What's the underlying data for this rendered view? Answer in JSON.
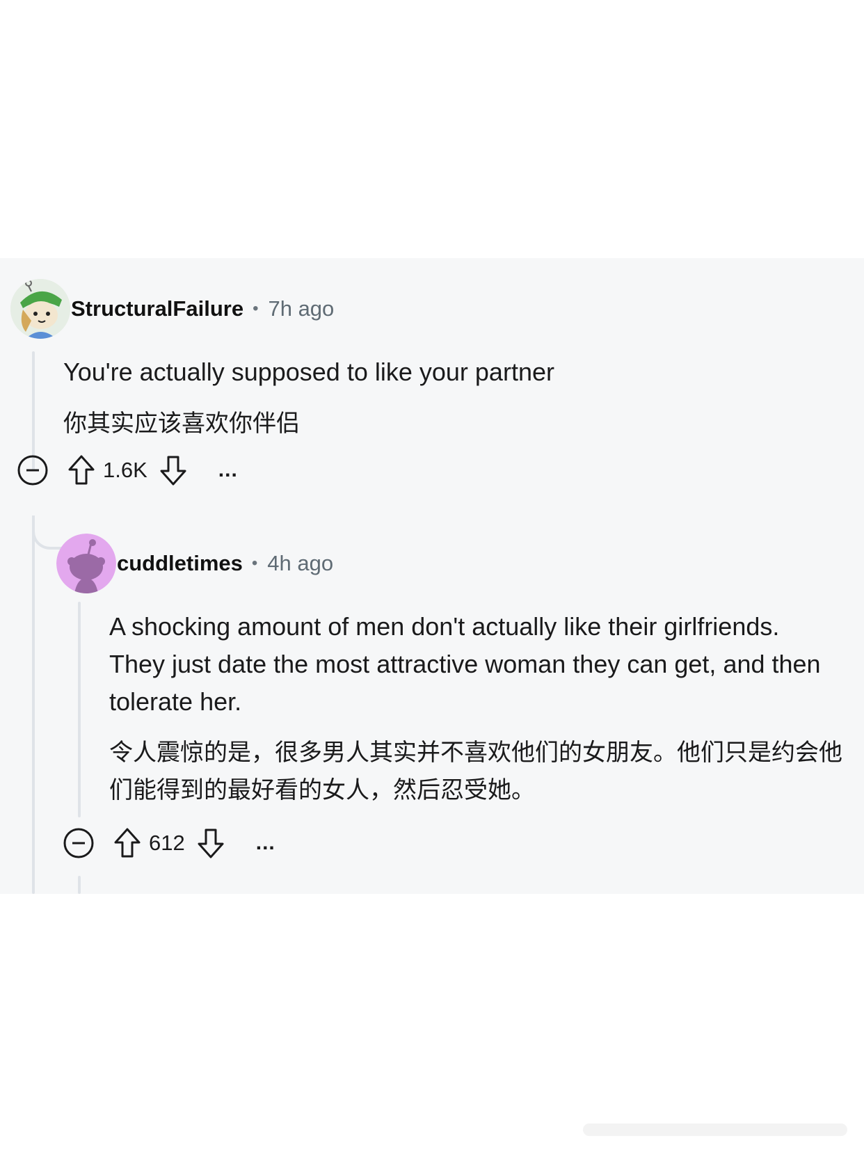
{
  "comments": [
    {
      "username": "StructuralFailure",
      "separator": "•",
      "time": "7h ago",
      "text_en": "You're actually supposed to like your partner",
      "text_zh": "你其实应该喜欢你伴侣",
      "votes": "1.6K",
      "more_label": "..."
    },
    {
      "username": "cuddletimes",
      "separator": "•",
      "time": "4h ago",
      "text_en": "A shocking amount of men don't actually like their girlfriends. They just date the most attractive woman they can get, and then tolerate her.",
      "text_zh": "令人震惊的是，很多男人其实并不喜欢他们的女朋友。他们只是约会他们能得到的最好看的女人，然后忍受她。",
      "votes": "612",
      "more_label": "..."
    }
  ],
  "icons": {
    "collapse": "minus-circle-icon",
    "upvote": "arrow-up-icon",
    "downvote": "arrow-down-icon",
    "more": "ellipsis-icon",
    "avatar1": "snoo-green-hat-avatar",
    "avatar2": "default-snoo-avatar"
  },
  "colors": {
    "panel": "#f6f7f8",
    "thread_line": "#dfe3e8",
    "avatar2_bg": "#e3a8ee",
    "avatar2_fg": "#9b6aa6"
  }
}
